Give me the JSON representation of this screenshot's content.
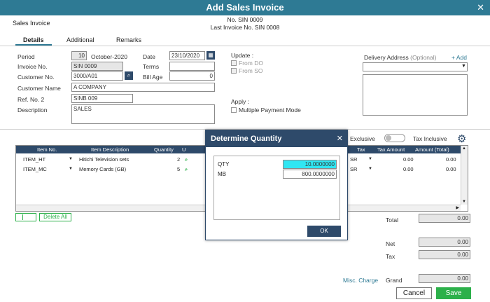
{
  "window": {
    "title": "Add Sales Invoice"
  },
  "header": {
    "doc_type": "Sales Invoice",
    "number_line": "No. SIN 0009",
    "last_invoice_line": "Last Invoice No. SIN 0008"
  },
  "tabs": [
    {
      "label": "Details"
    },
    {
      "label": "Additional"
    },
    {
      "label": "Remarks"
    }
  ],
  "form": {
    "period_label": "Period",
    "period_value": "10",
    "period_text": "October-2020",
    "date_label": "Date",
    "date_value": "23/10/2020",
    "invoice_label": "Invoice No.",
    "invoice_value": "SIN 0009",
    "terms_label": "Terms",
    "terms_value": "",
    "customer_no_label": "Customer No.",
    "customer_no_value": "3000/A01",
    "bill_age_label": "Bill Age",
    "bill_age_value": "0",
    "customer_name_label": "Customer Name",
    "customer_name_value": "A COMPANY",
    "ref_label": "Ref. No. 2",
    "ref_value": "SINB 009",
    "description_label": "Description",
    "description_value": "SALES"
  },
  "update": {
    "label": "Update :",
    "from_do": "From DO",
    "from_so": "From SO"
  },
  "apply": {
    "label": "Apply :",
    "multiple_payment": "Multiple Payment Mode"
  },
  "delivery": {
    "label": "Delivery Address",
    "optional": "(Optional)",
    "add": "+ Add"
  },
  "tax_toggle": {
    "exclusive": "Exclusive",
    "inclusive": "Tax Inclusive"
  },
  "grid": {
    "columns": [
      "Item No.",
      "Item Description",
      "Quantity",
      "U",
      "Tax",
      "Tax Amount",
      "Amount (Total)"
    ],
    "rows": [
      {
        "item": "ITEM_HT",
        "desc": "Hitichi Television sets",
        "qty": "2",
        "tax": "SR",
        "tax_amount": "0.00",
        "amount": "0.00"
      },
      {
        "item": "ITEM_MC",
        "desc": "Memory Cards (GB)",
        "qty": "5",
        "tax": "SR",
        "tax_amount": "0.00",
        "amount": "0.00"
      }
    ],
    "delete_all": "Delete All"
  },
  "totals": {
    "total_label": "Total",
    "total_value": "0.00",
    "net_label": "Net",
    "net_value": "0.00",
    "tax_label": "Tax",
    "tax_value": "0.00",
    "misc_charge": "Misc. Charge",
    "grand_label": "Grand",
    "grand_value": "0.00"
  },
  "buttons": {
    "cancel": "Cancel",
    "save": "Save"
  },
  "dialog": {
    "title": "Determine Quantity",
    "rows": [
      {
        "label": "QTY",
        "value": "10.0000000"
      },
      {
        "label": "MB",
        "value": "800.0000000"
      }
    ],
    "ok": "OK"
  },
  "colors": {
    "accent": "#2e7a94",
    "header_dark": "#2e4a6a",
    "save_green": "#2cb04a",
    "qty_highlight": "#2fe6f2"
  }
}
